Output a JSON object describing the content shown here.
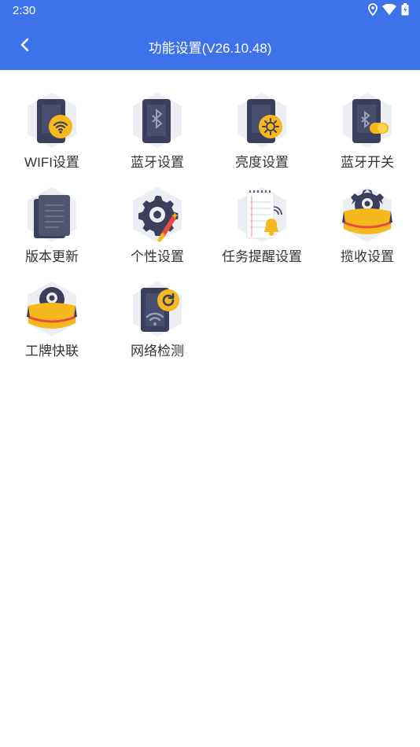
{
  "status_bar": {
    "time": "2:30"
  },
  "header": {
    "title": "功能设置(V26.10.48)"
  },
  "items": [
    {
      "label": "WIFI设置",
      "icon": "wifi-settings-icon"
    },
    {
      "label": "蓝牙设置",
      "icon": "bluetooth-settings-icon"
    },
    {
      "label": "亮度设置",
      "icon": "brightness-settings-icon"
    },
    {
      "label": "蓝牙开关",
      "icon": "bluetooth-toggle-icon"
    },
    {
      "label": "版本更新",
      "icon": "version-update-icon"
    },
    {
      "label": "个性设置",
      "icon": "personalization-icon"
    },
    {
      "label": "任务提醒设置",
      "icon": "task-reminder-icon"
    },
    {
      "label": "揽收设置",
      "icon": "pickup-settings-icon"
    },
    {
      "label": "工牌快联",
      "icon": "badge-quick-link-icon"
    },
    {
      "label": "网络检测",
      "icon": "network-check-icon"
    }
  ],
  "colors": {
    "header": "#3d72ea",
    "accent": "#f5b81d",
    "device": "#3c3f5c"
  }
}
